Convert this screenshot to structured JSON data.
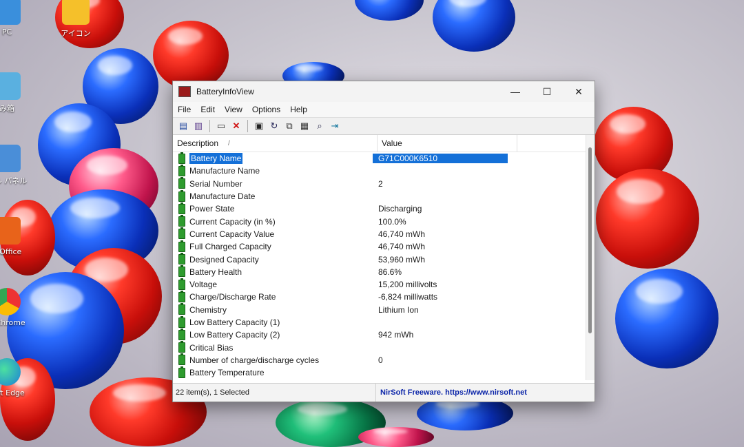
{
  "desktop": {
    "icons": [
      {
        "label": "PC"
      },
      {
        "label": "アイコン"
      },
      {
        "label": "み箱"
      },
      {
        "label": "ール パネル"
      },
      {
        "label": "S Office"
      },
      {
        "label": "e Chrome"
      },
      {
        "label": "soft Edge"
      }
    ]
  },
  "window": {
    "title": "BatteryInfoView",
    "controls": {
      "minimize": "—",
      "maximize": "☐",
      "close": "✕"
    },
    "menu": [
      "File",
      "Edit",
      "View",
      "Options",
      "Help"
    ],
    "columns": {
      "description": "Description",
      "sort_indicator": "/",
      "value": "Value"
    },
    "rows": [
      {
        "desc": "Battery Name",
        "value": "G71C000K6510"
      },
      {
        "desc": "Manufacture Name",
        "value": ""
      },
      {
        "desc": "Serial Number",
        "value": "2"
      },
      {
        "desc": "Manufacture Date",
        "value": ""
      },
      {
        "desc": "Power State",
        "value": "Discharging"
      },
      {
        "desc": "Current Capacity (in %)",
        "value": "100.0%"
      },
      {
        "desc": "Current Capacity Value",
        "value": "46,740 mWh"
      },
      {
        "desc": "Full Charged Capacity",
        "value": "46,740 mWh"
      },
      {
        "desc": "Designed Capacity",
        "value": "53,960 mWh"
      },
      {
        "desc": "Battery Health",
        "value": "86.6%"
      },
      {
        "desc": "Voltage",
        "value": "15,200 millivolts"
      },
      {
        "desc": "Charge/Discharge Rate",
        "value": "-6,824 milliwatts"
      },
      {
        "desc": "Chemistry",
        "value": "Lithium Ion"
      },
      {
        "desc": "Low Battery Capacity (1)",
        "value": ""
      },
      {
        "desc": "Low Battery Capacity (2)",
        "value": "942 mWh"
      },
      {
        "desc": "Critical Bias",
        "value": ""
      },
      {
        "desc": "Number of charge/discharge cycles",
        "value": "0"
      },
      {
        "desc": "Battery Temperature",
        "value": ""
      }
    ],
    "status": {
      "count": "22 item(s), 1 Selected",
      "credit": "NirSoft Freeware. https://www.nirsoft.net"
    }
  },
  "colors": {
    "selection": "#1470d8",
    "credit_link": "#0a24a8"
  }
}
